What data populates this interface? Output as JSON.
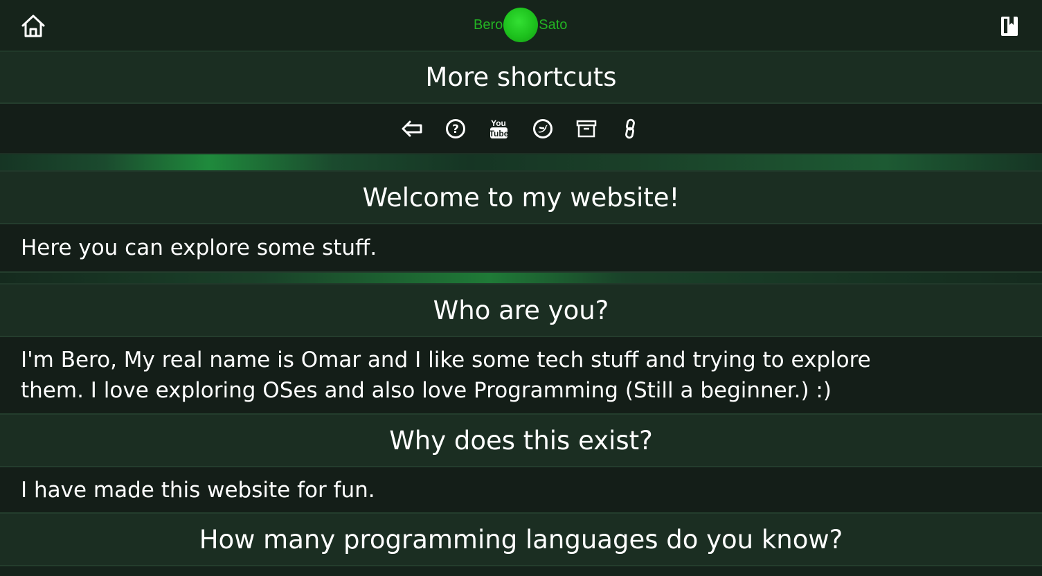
{
  "header": {
    "logo_left": "Bero",
    "logo_right": "Sato",
    "icons": [
      "home-icon",
      "book-icon"
    ]
  },
  "shortcuts": {
    "title": "More shortcuts",
    "icons": [
      "back-arrow-icon",
      "help-circle-icon",
      "youtube-icon",
      "twitter-icon",
      "archive-icon",
      "link-icon"
    ]
  },
  "sections": [
    {
      "title": "Welcome to my website!",
      "body": "Here you can explore some stuff."
    },
    {
      "title": "Who are you?",
      "body": "I'm Bero, My real name is Omar and I like some tech stuff and trying to explore them. I love exploring OSes and also love Programming (Still a beginner.) :)"
    },
    {
      "title": "Why does this exist?",
      "body": "I have made this website for fun."
    },
    {
      "title": "How many programming languages do you know?"
    }
  ],
  "colors": {
    "accent": "#23b423",
    "background": "#15231b",
    "text": "#ffffff"
  }
}
